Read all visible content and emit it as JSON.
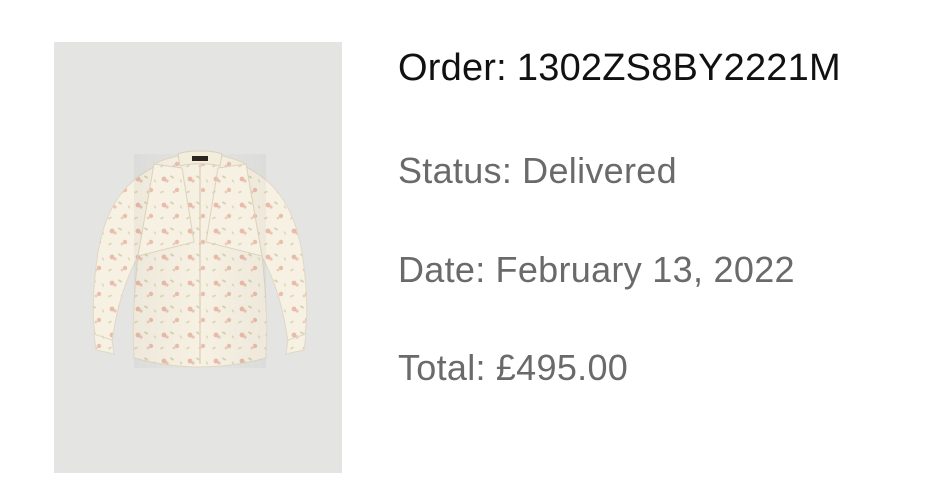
{
  "order": {
    "label": "Order:",
    "number": "1302ZS8BY2221M"
  },
  "status": {
    "label": "Status:",
    "value": "Delivered"
  },
  "date": {
    "label": "Date:",
    "value": "February 13, 2022"
  },
  "total": {
    "label": "Total:",
    "value": "£495.00"
  },
  "product": {
    "image_icon": "floral-blouse-image",
    "colors": {
      "background": "#e4e4e3",
      "fabric": "#f6f1e3",
      "print": "#e6b2a0",
      "leaf": "#c9c79a",
      "label": "#2a2520"
    }
  }
}
